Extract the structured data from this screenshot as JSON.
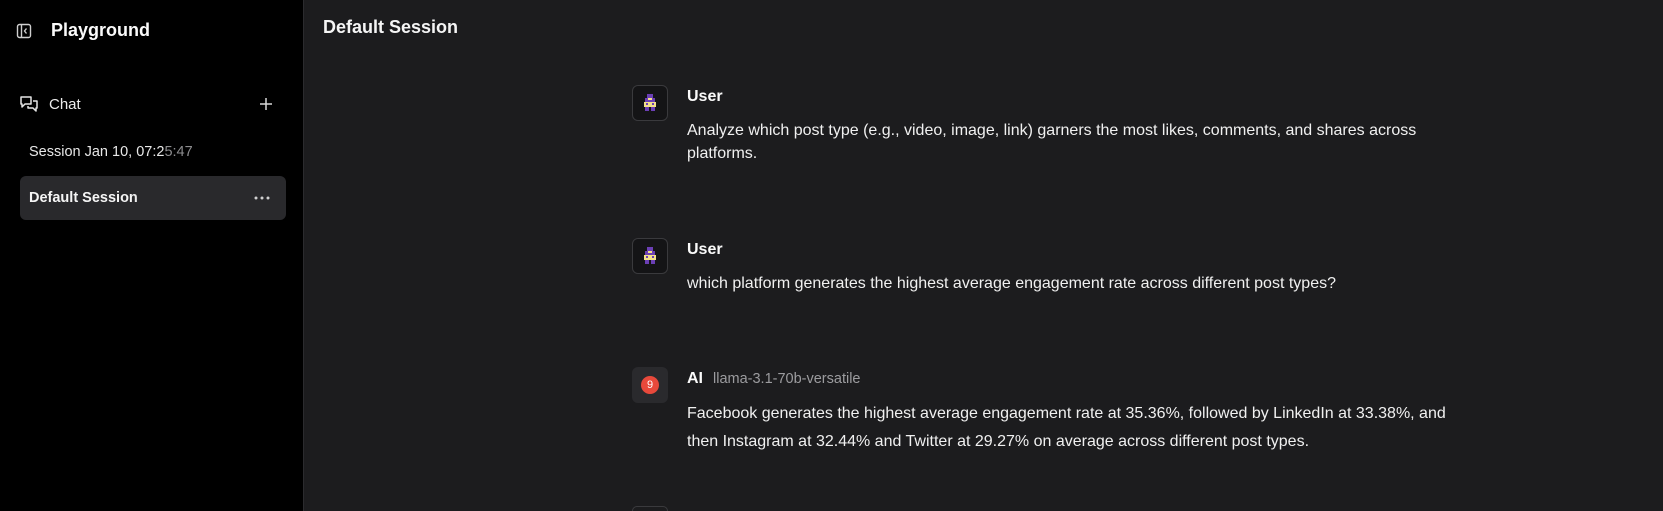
{
  "sidebar": {
    "app_title": "Playground",
    "collapse_icon": "sidebar-collapse-icon",
    "chat_label": "Chat",
    "sessions": [
      {
        "prefix": "Session Jan 10, 07:2",
        "suffix": "5:47"
      },
      {
        "label": "Default Session"
      }
    ]
  },
  "main": {
    "title": "Default Session",
    "messages": [
      {
        "author": "User",
        "text": "Analyze which post type (e.g., video, image, link) garners the most likes, comments, and shares across platforms."
      },
      {
        "author": "User",
        "text": "which platform generates the highest average engagement rate across different post types?"
      },
      {
        "author": "AI",
        "model": "llama-3.1-70b-versatile",
        "badge": "9",
        "text": "Facebook generates the highest average engagement rate at 35.36%, followed by LinkedIn at 33.38%, and then Instagram at 32.44% and Twitter at 29.27% on average across different post types."
      }
    ]
  },
  "colors": {
    "sidebar_bg": "#000000",
    "main_bg": "#1c1c1e",
    "active_session": "#29292c",
    "ai_badge": "#e8493b"
  }
}
